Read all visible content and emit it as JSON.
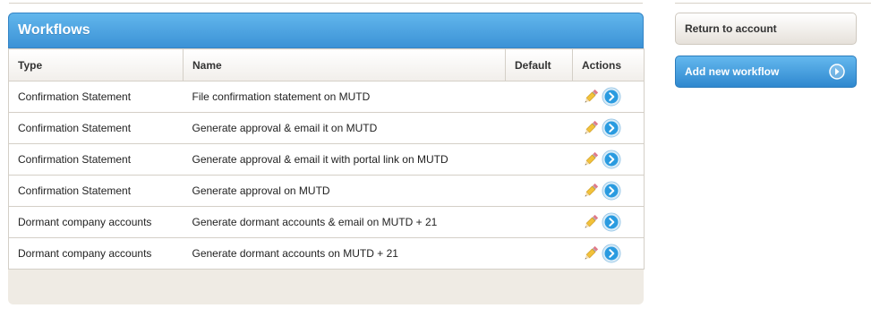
{
  "panel": {
    "title": "Workflows"
  },
  "table": {
    "columns": [
      "Type",
      "Name",
      "Default",
      "Actions"
    ],
    "rows": [
      {
        "type": "Confirmation Statement",
        "name": "File confirmation statement on MUTD",
        "default": ""
      },
      {
        "type": "Confirmation Statement",
        "name": "Generate approval & email it on MUTD",
        "default": ""
      },
      {
        "type": "Confirmation Statement",
        "name": "Generate approval & email it with portal link on MUTD",
        "default": ""
      },
      {
        "type": "Confirmation Statement",
        "name": "Generate approval on MUTD",
        "default": ""
      },
      {
        "type": "Dormant company accounts",
        "name": "Generate dormant accounts & email on MUTD + 21",
        "default": ""
      },
      {
        "type": "Dormant company accounts",
        "name": "Generate dormant accounts on MUTD + 21",
        "default": ""
      }
    ],
    "row_action_icons": [
      "pencil-edit-icon",
      "blue-circle-arrow-icon"
    ]
  },
  "sidebar": {
    "return_label": "Return to account",
    "add_label": "Add new workflow",
    "add_icon": "circle-arrow-right-icon"
  },
  "colors": {
    "header_blue": "#3c92d6",
    "panel_beige": "#efebe4",
    "go_icon_blue": "#2a9be0"
  }
}
